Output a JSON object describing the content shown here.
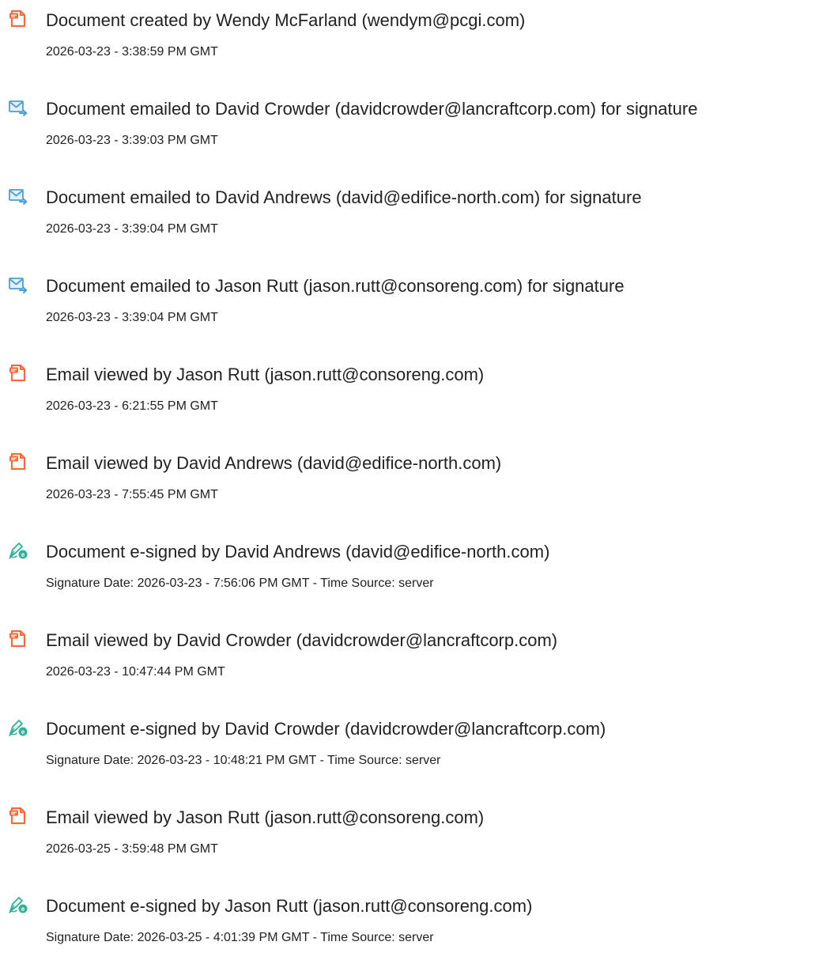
{
  "events": [
    {
      "icon": "document-created-icon",
      "title": "Document created by Wendy McFarland (wendym@pcgi.com)",
      "time": "2026-03-23 - 3:38:59 PM GMT"
    },
    {
      "icon": "email-sent-icon",
      "title": "Document emailed to David Crowder (davidcrowder@lancraftcorp.com) for signature",
      "time": "2026-03-23 - 3:39:03 PM GMT"
    },
    {
      "icon": "email-sent-icon",
      "title": "Document emailed to David Andrews (david@edifice-north.com) for signature",
      "time": "2026-03-23 - 3:39:04 PM GMT"
    },
    {
      "icon": "email-sent-icon",
      "title": "Document emailed to Jason Rutt (jason.rutt@consoreng.com) for signature",
      "time": "2026-03-23 - 3:39:04 PM GMT"
    },
    {
      "icon": "document-viewed-icon",
      "title": "Email viewed by Jason Rutt (jason.rutt@consoreng.com)",
      "time": "2026-03-23 - 6:21:55 PM GMT"
    },
    {
      "icon": "document-viewed-icon",
      "title": "Email viewed by David Andrews (david@edifice-north.com)",
      "time": "2026-03-23 - 7:55:45 PM GMT"
    },
    {
      "icon": "e-sign-icon",
      "title": "Document e-signed by David Andrews (david@edifice-north.com)",
      "time": "Signature Date: 2026-03-23 - 7:56:06 PM GMT - Time Source: server"
    },
    {
      "icon": "document-viewed-icon",
      "title": "Email viewed by David Crowder (davidcrowder@lancraftcorp.com)",
      "time": "2026-03-23 - 10:47:44 PM GMT"
    },
    {
      "icon": "e-sign-icon",
      "title": "Document e-signed by David Crowder (davidcrowder@lancraftcorp.com)",
      "time": "Signature Date: 2026-03-23 - 10:48:21 PM GMT - Time Source: server"
    },
    {
      "icon": "document-viewed-icon",
      "title": "Email viewed by Jason Rutt (jason.rutt@consoreng.com)",
      "time": "2026-03-25 - 3:59:48 PM GMT"
    },
    {
      "icon": "e-sign-icon",
      "title": "Document e-signed by Jason Rutt (jason.rutt@consoreng.com)",
      "time": "Signature Date: 2026-03-25 - 4:01:39 PM GMT - Time Source: server"
    }
  ],
  "colors": {
    "document_icon": "#f26a3d",
    "email_icon": "#4a9fd8",
    "esign_icon": "#2eb398",
    "text": "#222222"
  }
}
